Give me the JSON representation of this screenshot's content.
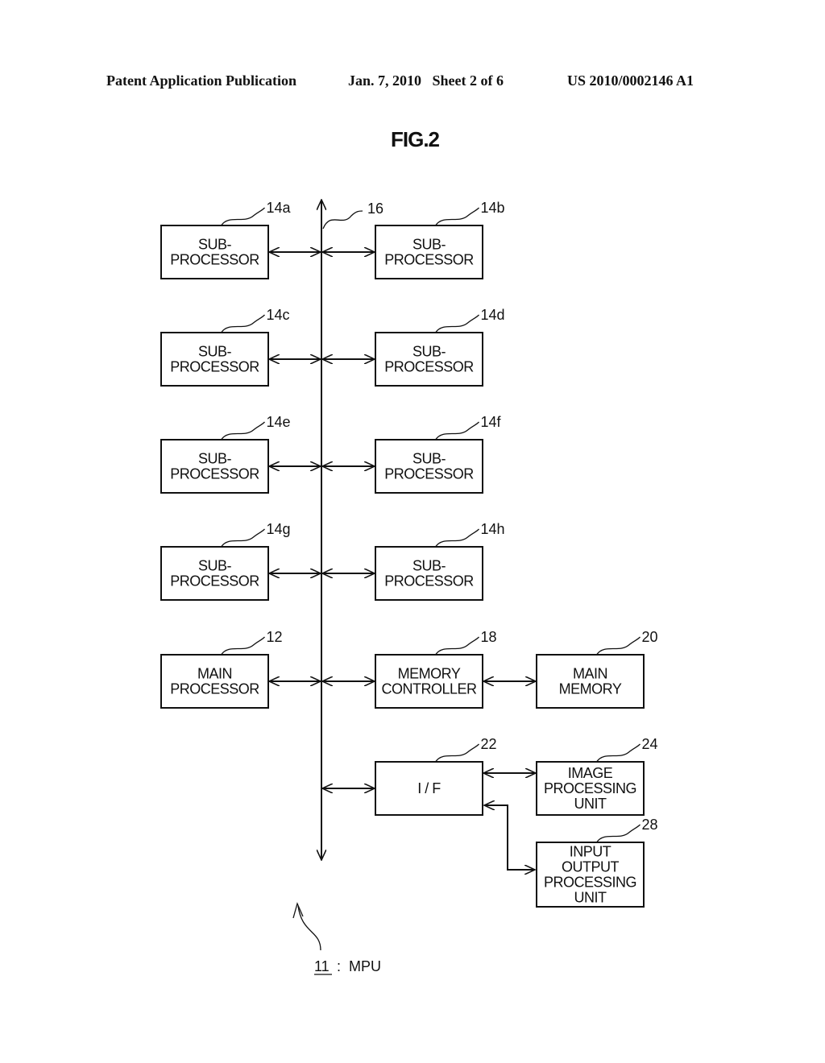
{
  "header": {
    "left": "Patent Application Publication",
    "center": "Jan. 7, 2010   Sheet 2 of 6",
    "right": "US 2010/0002146 A1"
  },
  "figure": {
    "title": "FIG.2",
    "bus_ref": "16",
    "caption_ref": "11",
    "caption_sep": " : ",
    "caption_text": "MPU"
  },
  "blocks": [
    {
      "id": "14a",
      "ref": "14a",
      "lines": [
        "SUB-",
        "PROCESSOR"
      ]
    },
    {
      "id": "14b",
      "ref": "14b",
      "lines": [
        "SUB-",
        "PROCESSOR"
      ]
    },
    {
      "id": "14c",
      "ref": "14c",
      "lines": [
        "SUB-",
        "PROCESSOR"
      ]
    },
    {
      "id": "14d",
      "ref": "14d",
      "lines": [
        "SUB-",
        "PROCESSOR"
      ]
    },
    {
      "id": "14e",
      "ref": "14e",
      "lines": [
        "SUB-",
        "PROCESSOR"
      ]
    },
    {
      "id": "14f",
      "ref": "14f",
      "lines": [
        "SUB-",
        "PROCESSOR"
      ]
    },
    {
      "id": "14g",
      "ref": "14g",
      "lines": [
        "SUB-",
        "PROCESSOR"
      ]
    },
    {
      "id": "14h",
      "ref": "14h",
      "lines": [
        "SUB-",
        "PROCESSOR"
      ]
    },
    {
      "id": "12",
      "ref": "12",
      "lines": [
        "MAIN",
        "PROCESSOR"
      ]
    },
    {
      "id": "18",
      "ref": "18",
      "lines": [
        "MEMORY",
        "CONTROLLER"
      ]
    },
    {
      "id": "20",
      "ref": "20",
      "lines": [
        "MAIN",
        "MEMORY"
      ]
    },
    {
      "id": "22",
      "ref": "22",
      "lines": [
        "I / F"
      ]
    },
    {
      "id": "24",
      "ref": "24",
      "lines": [
        "IMAGE",
        "PROCESSING",
        "UNIT"
      ]
    },
    {
      "id": "28",
      "ref": "28",
      "lines": [
        "INPUT",
        "OUTPUT",
        "PROCESSING",
        "UNIT"
      ]
    }
  ],
  "connections": [
    {
      "from": "14a",
      "to": "bus 16",
      "type": "bidirectional"
    },
    {
      "from": "14b",
      "to": "bus 16",
      "type": "bidirectional"
    },
    {
      "from": "14c",
      "to": "bus 16",
      "type": "bidirectional"
    },
    {
      "from": "14d",
      "to": "bus 16",
      "type": "bidirectional"
    },
    {
      "from": "14e",
      "to": "bus 16",
      "type": "bidirectional"
    },
    {
      "from": "14f",
      "to": "bus 16",
      "type": "bidirectional"
    },
    {
      "from": "14g",
      "to": "bus 16",
      "type": "bidirectional"
    },
    {
      "from": "14h",
      "to": "bus 16",
      "type": "bidirectional"
    },
    {
      "from": "12",
      "to": "bus 16",
      "type": "bidirectional"
    },
    {
      "from": "18",
      "to": "bus 16",
      "type": "bidirectional"
    },
    {
      "from": "18",
      "to": "20",
      "type": "bidirectional"
    },
    {
      "from": "22",
      "to": "bus 16",
      "type": "bidirectional"
    },
    {
      "from": "22",
      "to": "24",
      "type": "bidirectional"
    },
    {
      "from": "22",
      "to": "28",
      "type": "bidirectional"
    }
  ]
}
